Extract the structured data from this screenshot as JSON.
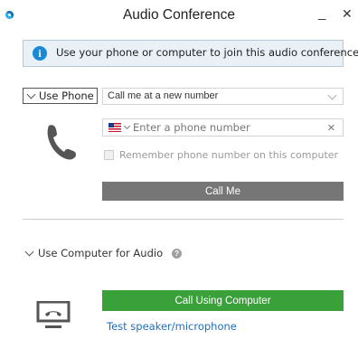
{
  "window": {
    "title": "Audio Conference",
    "minimize_glyph": "_",
    "close_glyph": "✕"
  },
  "info": {
    "icon_glyph": "i",
    "text": "Use your phone or computer to join this audio conference."
  },
  "phone": {
    "toggle_label": "Use Phone",
    "mode_value": "Call me at a new number",
    "number_placeholder": "Enter a phone number",
    "clear_glyph": "✕",
    "remember_label": "Remember phone number on this computer",
    "call_me_label": "Call Me"
  },
  "computer": {
    "header_label": "Use Computer for Audio",
    "help_glyph": "?",
    "call_label": "Call Using Computer",
    "test_link": "Test speaker/microphone"
  },
  "colors": {
    "accent_blue": "#1a8ad8",
    "call_me_gray": "#767676",
    "call_green": "#3aa13a",
    "link_blue": "#1e6fc0"
  },
  "icons": {
    "app": "webex-logo-icon",
    "info": "info-icon",
    "flag": "us-flag-icon",
    "handset": "phone-handset-icon",
    "computer": "computer-audio-icon",
    "help": "help-icon"
  }
}
